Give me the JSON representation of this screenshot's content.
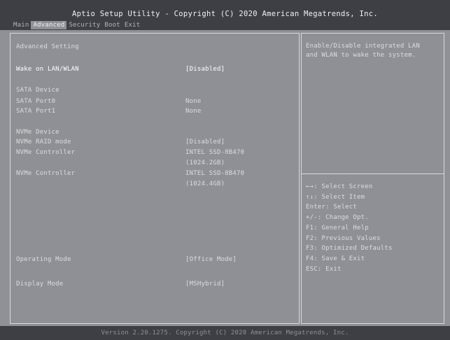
{
  "header": {
    "title": "Aptio Setup Utility - Copyright (C) 2020 American Megatrends, Inc.",
    "tabs": [
      {
        "label": "Main",
        "active": false
      },
      {
        "label": "Advanced",
        "active": true
      },
      {
        "label": "Security",
        "active": false
      },
      {
        "label": "Boot",
        "active": false
      },
      {
        "label": "Exit",
        "active": false
      }
    ]
  },
  "left": {
    "section_title": "Advanced Setting",
    "wake_label": "Wake on LAN/WLAN",
    "wake_value": "[Disabled]",
    "sata_header": "SATA Device",
    "sata_port0_label": "SATA Port0",
    "sata_port0_value": "None",
    "sata_port1_label": "SATA Port1",
    "sata_port1_value": "None",
    "nvme_header": "NVMe Device",
    "nvme_raid_label": "NVMe RAID mode",
    "nvme_raid_value": "[Disabled]",
    "nvme_ctrl1_label": "NVMe Controller",
    "nvme_ctrl1_value1": "INTEL SSD-8B470",
    "nvme_ctrl1_value2": "(1024.2GB)",
    "nvme_ctrl2_label": "NVMe Controller",
    "nvme_ctrl2_value1": "INTEL SSD-8B470",
    "nvme_ctrl2_value2": "(1024.4GB)",
    "operating_label": "Operating Mode",
    "operating_value": "[Office Mode]",
    "display_label": "Display Mode",
    "display_value": "[MSHybrid]"
  },
  "right": {
    "help_text": "Enable/Disable integrated LAN\nand WLAN to wake the system.",
    "keys": [
      "←→: Select Screen",
      "↑↓: Select Item",
      "Enter: Select",
      "+/-: Change Opt.",
      "F1: General Help",
      "F2: Previous Values",
      "F3: Optimized Defaults",
      "F4: Save & Exit",
      "ESC: Exit"
    ]
  },
  "footer": {
    "text": "Version 2.20.1275. Copyright (C) 2020 American Megatrends, Inc."
  }
}
